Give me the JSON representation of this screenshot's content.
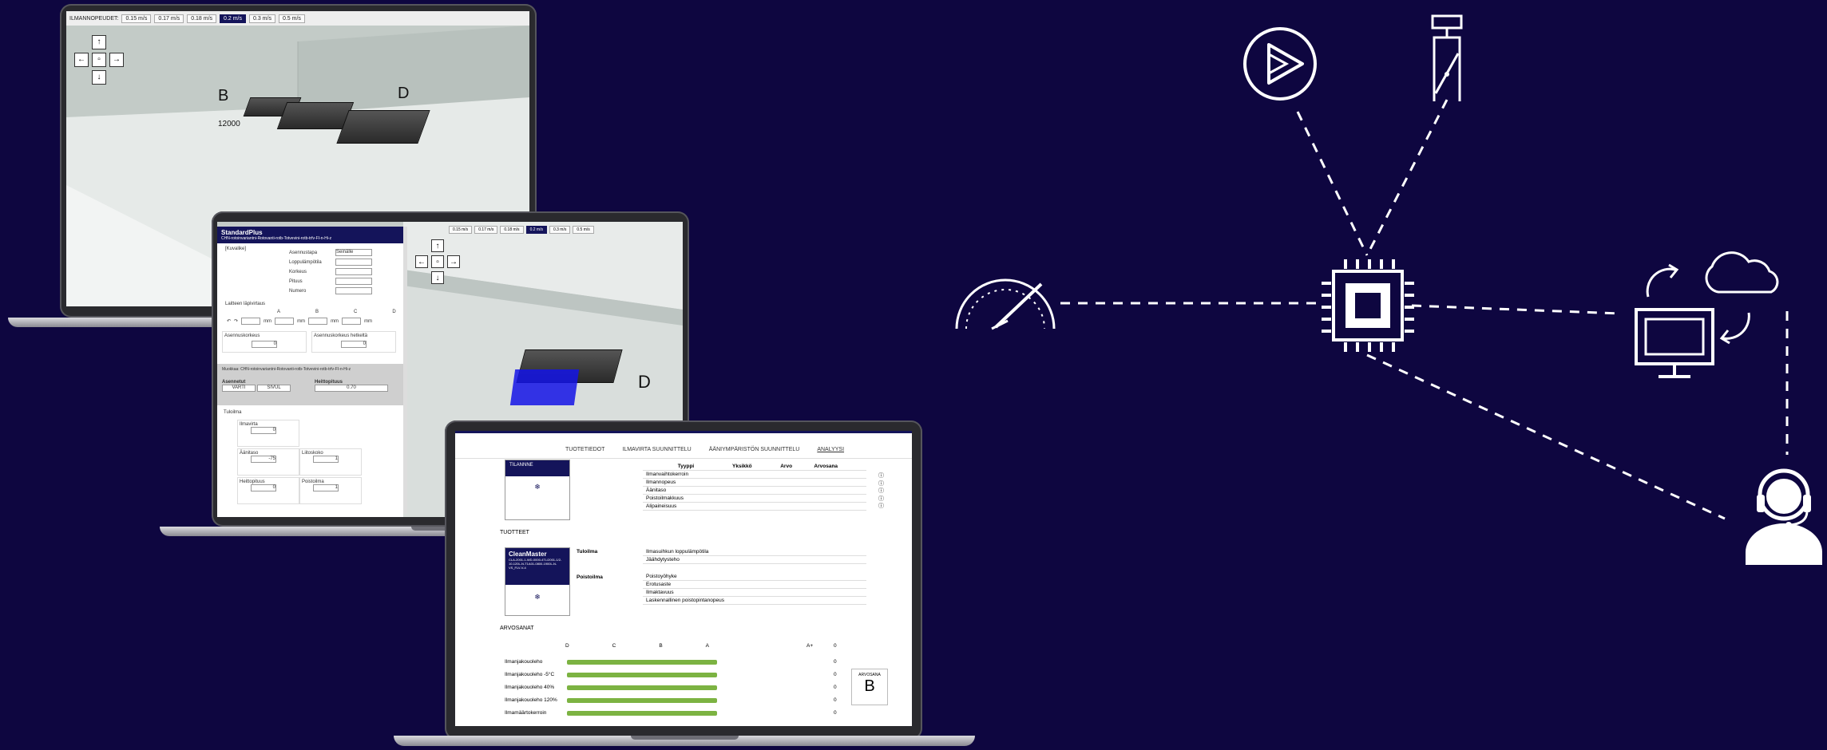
{
  "laptop1": {
    "speed_label": "ILMANNOPEUDET:",
    "speeds": [
      "0.15 m/s",
      "0.17 m/s",
      "0.18 m/s",
      "0.2 m/s",
      "0.3 m/s",
      "0.5 m/s"
    ],
    "selected_speed": "0.2 m/s",
    "labels": {
      "b": "B",
      "d": "D",
      "dim": "12000"
    }
  },
  "laptop2": {
    "panel_title": "StandardPlus",
    "panel_subtitle": "CHN-rotoinvariantni-Rotovanti-rotb-Totvevini-rotb-trfv-FI-n-Hi-z",
    "image_alt": "[Kuvalike]",
    "fields": [
      {
        "label": "Asennustapa",
        "value": "Seinälle"
      },
      {
        "label": "Loppulämpötila",
        "value": ""
      },
      {
        "label": "Korkeus",
        "value": ""
      },
      {
        "label": "Pituus",
        "value": ""
      },
      {
        "label": "Numero",
        "value": ""
      }
    ],
    "section_lapis": "Laitteen läpivirtaus",
    "cols": [
      "A",
      "B",
      "C",
      "D"
    ],
    "unit_mm": "mm",
    "a1_label": "Asennuskorkeus",
    "a1_value": "0",
    "a2_label": "Asennuskorkeus hetkeltä",
    "a2_value": "0",
    "gray_title": "Muokkaa: CHN-rotoinvariantni-Rotovanti-rotb-Totvevini-rotb-trfv-FI-n-Hi-z",
    "g1_label": "Asennetut",
    "g1_vals": [
      "VARTI",
      "SIVUL"
    ],
    "g2_label": "Heittopituus",
    "g2_val": "0.70",
    "tuloilma": "Tuloilma",
    "t1_label": "Ilmavirta",
    "t1_val": "0",
    "t2_label": "Äänitaso",
    "t2_val": "-75",
    "t3_label": "Liitoskoko",
    "t3_val": "1",
    "t4_label": "Heittopituus",
    "t4_val": "0",
    "t5_label": "Poistoilma",
    "t5_val": "1",
    "speeds": [
      "0.15 m/s",
      "0.17 m/s",
      "0.18 m/s",
      "0.2 m/s",
      "0.3 m/s",
      "0.5 m/s"
    ],
    "selected_speed": "0.2 m/s",
    "d_label": "D"
  },
  "laptop3": {
    "tabs": [
      "TUOTETIEDOT",
      "ILMAVIRTA SUUNNITTELU",
      "ÄÄNIYMPÄRISTÖN SUUNNITTELU",
      "ANALYYSI"
    ],
    "active_tab": "ANALYYSI",
    "tilanne_title": "TILANNNE",
    "table_headers": [
      "Tyyppi",
      "Yksikkö",
      "Arvo",
      "Arvosana"
    ],
    "tilanne_rows": [
      "Ilmanvaihtokerroin",
      "Ilmannopeus",
      "Äänitaso",
      "Poistoilmakkuus",
      "Alipaineisuus"
    ],
    "tuotteet_title": "TUOTTEET",
    "product_name": "CleanMaster",
    "product_desc": "CLA-2001-1-WD-0000-4TL/2001-1/2-10-120L-N-T1A01-0800-1900L-N-VS_FLV-V-4",
    "tuloilma_label": "Tuloilma",
    "tuloilma_rows": [
      "Ilmasuihkun loppulämpötila",
      "Jäähdytysteho"
    ],
    "poistoilma_label": "Poistoilma",
    "poistoilma_rows": [
      "Poistoyöhyke",
      "Erotusaste",
      "Ilmaktavuus",
      "Laskennallinen poistopintanopeus"
    ],
    "arvosanat_title": "ARVOSANAT",
    "grade_scale": [
      "D",
      "C",
      "B",
      "A",
      "A+"
    ],
    "grade_scale_zero": "0",
    "grade_rows": [
      {
        "label": "Ilmanjakouoleho",
        "score": "0",
        "level": 0.82
      },
      {
        "label": "Ilmanjakouoleho -5°C",
        "score": "0",
        "level": 0.82
      },
      {
        "label": "Ilmanjakouoleho 40%",
        "score": "0",
        "level": 0.82
      },
      {
        "label": "Ilmanjakouoleho 120%",
        "score": "0",
        "level": 0.82
      },
      {
        "label": "Ilmamäärtokerroin",
        "score": "0",
        "level": 0.82
      }
    ],
    "arvosana_label": "ARVOSANA",
    "arvosana_value": "B"
  },
  "colors": {
    "background": "#0e0640",
    "accent": "#14145a",
    "bar": "#7cb342",
    "line": "#ffffff"
  },
  "diagram_icons": [
    "play-icon",
    "valve-icon",
    "gauge-icon",
    "chip-icon",
    "cloud-sync-icon",
    "monitor-icon",
    "support-agent-icon"
  ]
}
